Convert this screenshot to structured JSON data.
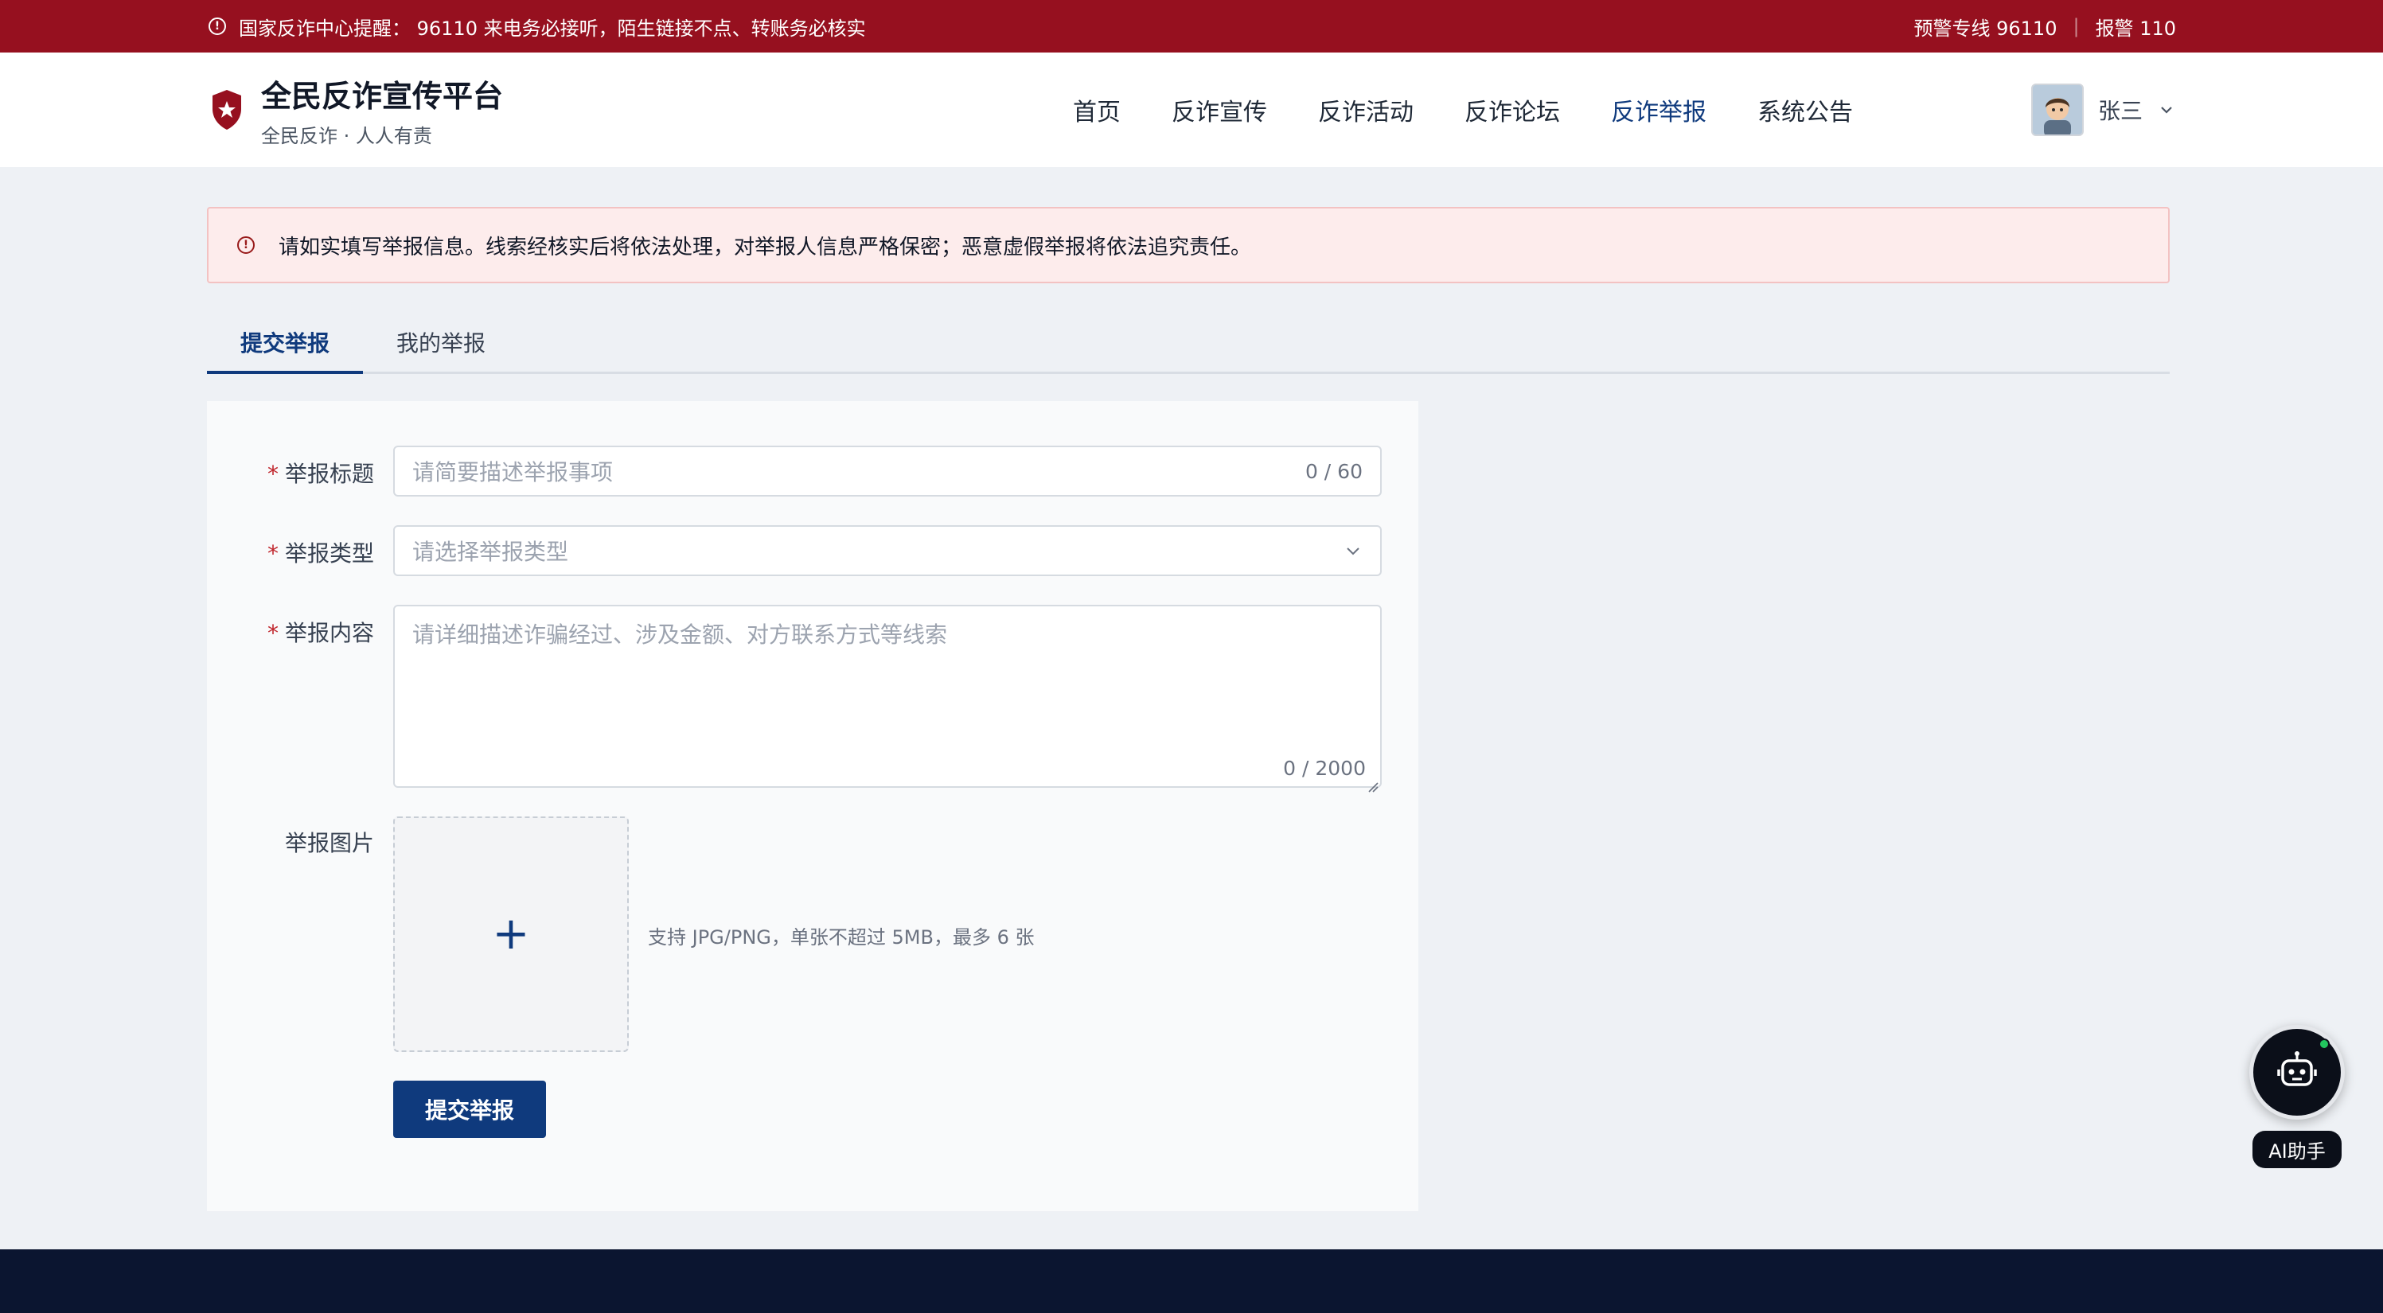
{
  "topbar": {
    "alert_text": "国家反诈中心提醒： 96110 来电务必接听，陌生链接不点、转账务必核实",
    "hotline": "预警专线 96110",
    "police": "报警 110",
    "separator": "|"
  },
  "brand": {
    "title": "全民反诈宣传平台",
    "subtitle": "全民反诈 · 人人有责"
  },
  "nav": {
    "items": [
      {
        "label": "首页"
      },
      {
        "label": "反诈宣传"
      },
      {
        "label": "反诈活动"
      },
      {
        "label": "反诈论坛"
      },
      {
        "label": "反诈举报",
        "active": true
      },
      {
        "label": "系统公告"
      }
    ]
  },
  "user": {
    "name": "张三"
  },
  "notice": {
    "text": "请如实填写举报信息。线索经核实后将依法处理，对举报人信息严格保密；恶意虚假举报将依法追究责任。"
  },
  "tabs": [
    {
      "label": "提交举报",
      "active": true
    },
    {
      "label": "我的举报"
    }
  ],
  "form": {
    "title": {
      "label": "举报标题",
      "placeholder": "请简要描述举报事项",
      "counter": "0 / 60"
    },
    "type": {
      "label": "举报类型",
      "placeholder": "请选择举报类型"
    },
    "content": {
      "label": "举报内容",
      "placeholder": "请详细描述诈骗经过、涉及金额、对方联系方式等线索",
      "counter": "0 / 2000"
    },
    "images": {
      "label": "举报图片",
      "hint": "支持 JPG/PNG，单张不超过 5MB，最多 6 张",
      "plus": "+"
    },
    "submit_label": "提交举报"
  },
  "ai_assistant": {
    "label": "AI助手"
  },
  "colors": {
    "topbar": "#96101f",
    "primary": "#0f3a7d",
    "required": "#c0262d",
    "footer": "#0b1530"
  }
}
